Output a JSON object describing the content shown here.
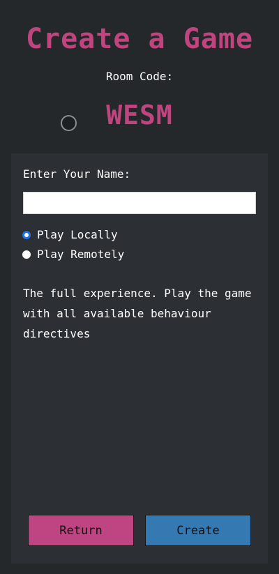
{
  "header": {
    "title": "Create a Game",
    "room_code_label": "Room Code:",
    "room_code": "WESM"
  },
  "form": {
    "name_label": "Enter Your Name:",
    "name_value": "",
    "play_mode": {
      "options": [
        {
          "label": "Play Locally",
          "checked": true
        },
        {
          "label": "Play Remotely",
          "checked": false
        }
      ]
    },
    "description": "The full experience. Play the game with all available behaviour directives"
  },
  "buttons": {
    "return_label": "Return",
    "create_label": "Create"
  },
  "colors": {
    "accent_pink": "#c0457f",
    "accent_blue": "#3579b3",
    "background": "#24282b",
    "panel": "#2c3034",
    "radio_checked": "#1f72e0"
  },
  "icons": {
    "loading": "loading-spinner-icon"
  }
}
